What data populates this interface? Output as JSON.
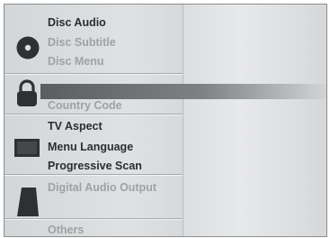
{
  "menu": {
    "group1": {
      "icon": "disc-icon",
      "items": [
        {
          "label": "Disc Audio",
          "state": "dark"
        },
        {
          "label": "Disc Subtitle",
          "state": "dim"
        },
        {
          "label": "Disc Menu",
          "state": "dim"
        }
      ]
    },
    "group2": {
      "icon": "lock-icon",
      "items": [
        {
          "label": "",
          "state": "selected"
        },
        {
          "label": "Country Code",
          "state": "dim"
        }
      ]
    },
    "group3": {
      "icon": "tv-icon",
      "items": [
        {
          "label": "TV Aspect",
          "state": "dark"
        },
        {
          "label": "Menu Language",
          "state": "dark"
        },
        {
          "label": "Progressive Scan",
          "state": "dark"
        }
      ]
    },
    "group4": {
      "icon": "speaker-icon",
      "items": [
        {
          "label": "Digital Audio Output",
          "state": "dim"
        }
      ]
    },
    "group5": {
      "items": [
        {
          "label": "Others",
          "state": "dim"
        }
      ]
    }
  },
  "colors": {
    "text_dark": "#2b2d2f",
    "text_dim": "#9fa2a4",
    "highlight": "#5b5d60"
  }
}
